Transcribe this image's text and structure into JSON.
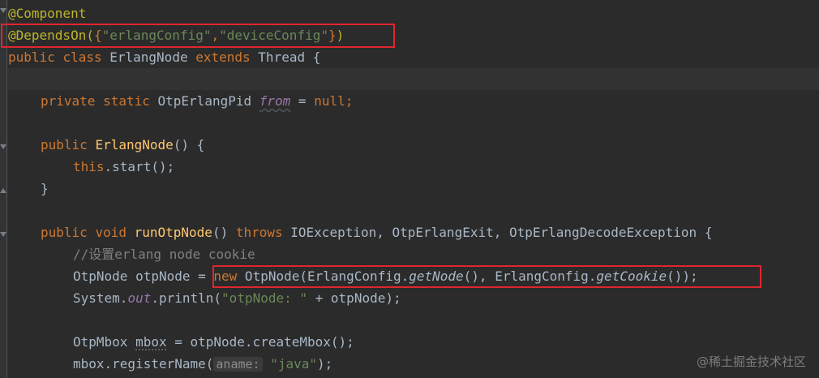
{
  "editor": {
    "lines": {
      "l1": {
        "ann": "@Component"
      },
      "l2": {
        "ann": "@DependsOn(",
        "brace_open": "{",
        "s1": "\"erlangConfig\"",
        "comma": ",",
        "s2": "\"deviceConfig\"",
        "brace_close": "}",
        "paren": ")"
      },
      "l3": {
        "kw1": "public",
        "kw2": "class",
        "name": "ErlangNode",
        "kw3": "extends",
        "super": "Thread",
        "brace": "{"
      },
      "l5": {
        "kw1": "private",
        "kw2": "static",
        "type": "OtpErlangPid",
        "field": "from",
        "eq": " = ",
        "null": "null",
        "semi": ";"
      },
      "l7": {
        "kw": "public",
        "name": "ErlangNode",
        "rest": "() {"
      },
      "l8": {
        "kw": "this",
        "rest": ".start();"
      },
      "l9": {
        "brace": "}"
      },
      "l11": {
        "kw1": "public",
        "kw2": "void",
        "name": "runOtpNode",
        "paren": "() ",
        "kw3": "throws",
        "rest": " IOException, OtpErlangExit, OtpErlangDecodeException {"
      },
      "l12": {
        "comment": "//设置erlang node cookie"
      },
      "l13": {
        "pre": "OtpNode otpNode = ",
        "kw": "new",
        "ctor": " OtpNode(ErlangConfig.",
        "m1": "getNode",
        "mid": "(), ErlangConfig.",
        "m2": "getCookie",
        "end": "());"
      },
      "l14": {
        "pre": "System.",
        "out": "out",
        "mid": ".println(",
        "str": "\"otpNode: \"",
        "end": " + otpNode);"
      },
      "l16": {
        "pre": "OtpMbox ",
        "var": "mbox",
        "end": " = otpNode.createMbox();"
      },
      "l17": {
        "pre": "mbox.registerName(",
        "hint": "aname:",
        "str": "\"java\"",
        "end": ");"
      }
    }
  },
  "watermark": "@稀土掘金技术社区",
  "colors": {
    "background": "#2b2b2b",
    "annotation": "#bbb529",
    "keyword": "#cc7832",
    "string": "#6a8759",
    "method_decl": "#ffc66d",
    "static_field": "#9876aa",
    "comment": "#808080",
    "highlight_box": "#e0262f"
  }
}
